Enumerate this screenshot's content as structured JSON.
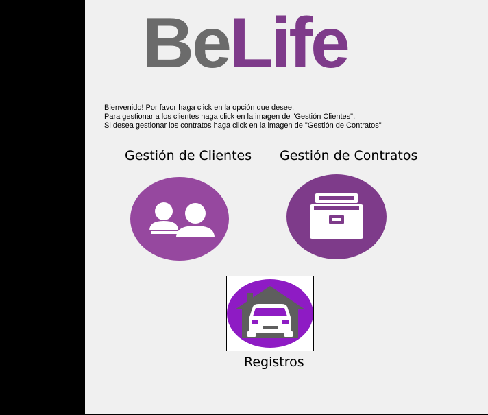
{
  "window": {
    "logo": {
      "part1": "Be",
      "part2": "Life"
    },
    "instructions": [
      "Bienvenido! Por favor haga click en la opción que desee.",
      "Para gestionar a los clientes haga click en la imagen de \"Gestión Clientes\".",
      "Si desea gestionar los contratos haga click en la imagen de \"Gestión de Contratos\""
    ]
  },
  "options": {
    "clientes": {
      "label": "Gestión de Clientes",
      "icon": "users-icon"
    },
    "contratos": {
      "label": "Gestión de Contratos",
      "icon": "file-cabinet-icon"
    },
    "registros": {
      "label": "Registros",
      "icon": "car-garage-icon"
    }
  },
  "colors": {
    "purple_light": "#96489f",
    "purple_dark": "#7e3b8a",
    "purple_bright": "#8e1bc4",
    "logo_gray": "#6b6b6b",
    "garage_gray": "#5e5e5e"
  }
}
